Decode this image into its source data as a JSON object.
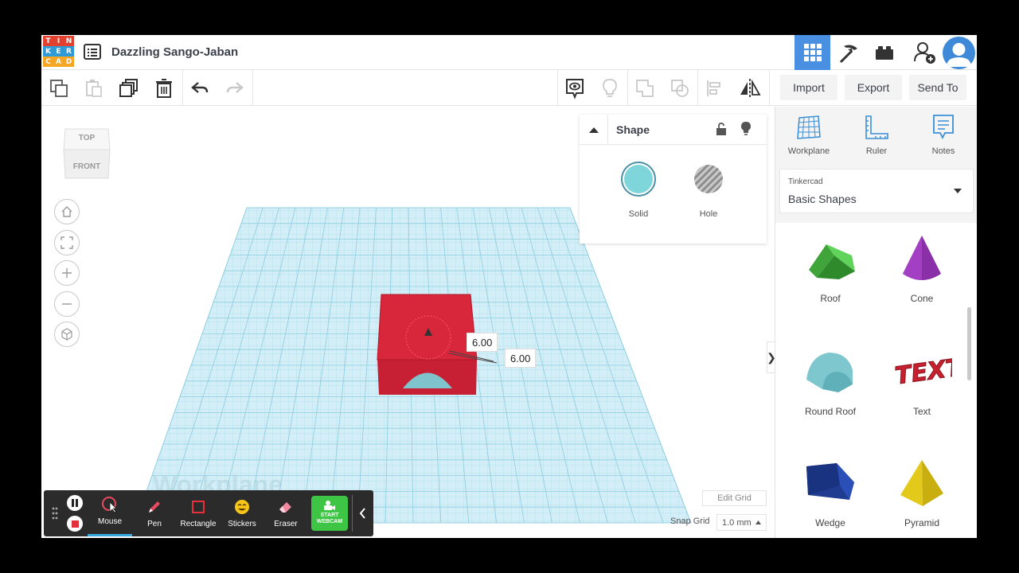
{
  "header": {
    "logo_letters": [
      "T",
      "I",
      "N",
      "K",
      "E",
      "R",
      "C",
      "A",
      "D"
    ],
    "logo_colors": [
      "#e2412f",
      "#e2412f",
      "#e2412f",
      "#2e9ad6",
      "#2e9ad6",
      "#2e9ad6",
      "#f5a623",
      "#f5a623",
      "#f5a623"
    ],
    "doc_title": "Dazzling Sango-Jaban",
    "accent": "#4a90e2"
  },
  "toolbar": {
    "import_label": "Import",
    "export_label": "Export",
    "send_to_label": "Send To"
  },
  "view_cube": {
    "top_label": "TOP",
    "front_label": "FRONT"
  },
  "shape_panel": {
    "title": "Shape",
    "solid_label": "Solid",
    "hole_label": "Hole",
    "solid_color": "#7fd6da"
  },
  "dimensions": {
    "dim1": "6.00",
    "dim2": "6.00"
  },
  "grid": {
    "edit_grid_label": "Edit Grid",
    "snap_grid_label": "Snap Grid",
    "snap_value": "1.0 mm"
  },
  "recorder": {
    "tools": [
      {
        "label": "Mouse"
      },
      {
        "label": "Pen"
      },
      {
        "label": "Rectangle"
      },
      {
        "label": "Stickers"
      },
      {
        "label": "Eraser"
      }
    ],
    "webcam_label_1": "START",
    "webcam_label_2": "WEBCAM"
  },
  "right_panel": {
    "tools": [
      {
        "label": "Workplane"
      },
      {
        "label": "Ruler"
      },
      {
        "label": "Notes"
      }
    ],
    "library_source": "Tinkercad",
    "library_name": "Basic Shapes",
    "shapes": [
      {
        "label": "Roof",
        "icon": "roof-icon"
      },
      {
        "label": "Cone",
        "icon": "cone-icon"
      },
      {
        "label": "Round Roof",
        "icon": "round-roof-icon"
      },
      {
        "label": "Text",
        "icon": "text-shape-icon"
      },
      {
        "label": "Wedge",
        "icon": "wedge-icon"
      },
      {
        "label": "Pyramid",
        "icon": "pyramid-icon"
      }
    ]
  }
}
